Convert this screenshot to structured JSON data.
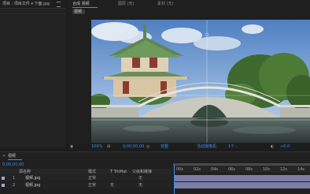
{
  "project_panel": {
    "tab_label": "项目 : 项目文件 ▾ 下面.jpg",
    "menu_icon": "menu-icon"
  },
  "composition_panel": {
    "tabs": [
      {
        "label": "合成 视频",
        "active": true
      },
      {
        "label": "图层 (无)",
        "active": false
      },
      {
        "label": "素材 (无)",
        "active": false
      }
    ],
    "sub_tab": "视频",
    "viewer_toolbar": {
      "zoom": "100%",
      "timecode": "0;00;00;00",
      "quality": "完整",
      "camera": "活动摄像机",
      "views": "1个...",
      "offset": "+0.0"
    }
  },
  "timeline": {
    "tab_label": "视频",
    "timecode": "0;00;00;00",
    "columns": {
      "name": "源名称",
      "mode": "模式",
      "trkmat": "T TrkMat",
      "parent": "父级和链接"
    },
    "ruler": [
      "00s",
      "02s",
      "04s",
      "06s",
      "08s",
      "10s",
      "12s",
      "14s"
    ],
    "layers": [
      {
        "num": "1",
        "name": "视频.jpg",
        "mode": "正常",
        "trkmat": "",
        "parent": "无"
      },
      {
        "num": "2",
        "name": "视频.jpg",
        "mode": "正常",
        "trkmat": "无",
        "parent": "无"
      }
    ]
  },
  "colors": {
    "accent": "#2d8ceb",
    "layer_bar": "#7b7fa7",
    "layer_label": "#a9a3d6"
  }
}
